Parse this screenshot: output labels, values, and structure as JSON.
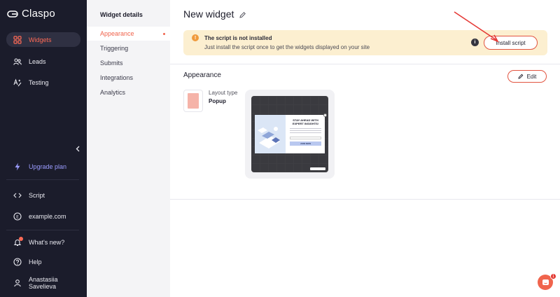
{
  "app": {
    "name": "Claspo"
  },
  "sidebar": {
    "items": [
      {
        "label": "Widgets",
        "icon": "grid-icon",
        "active": true
      },
      {
        "label": "Leads",
        "icon": "users-icon"
      },
      {
        "label": "Testing",
        "icon": "ab-test-icon"
      }
    ],
    "upgrade_label": "Upgrade plan",
    "script_label": "Script",
    "site_label": "example.com",
    "whats_new_label": "What's new?",
    "help_label": "Help",
    "user_first": "Anastasiia",
    "user_last": "Savelieva"
  },
  "subnav": {
    "title": "Widget details",
    "items": [
      {
        "label": "Appearance",
        "active": true
      },
      {
        "label": "Triggering"
      },
      {
        "label": "Submits"
      },
      {
        "label": "Integrations"
      },
      {
        "label": "Analytics"
      }
    ]
  },
  "main": {
    "title": "New widget",
    "alert": {
      "title": "The script is not installed",
      "subtitle": "Just install the script once to get the widgets displayed on your site",
      "button_label": "Install script"
    },
    "section_title": "Appearance",
    "edit_label": "Edit",
    "layout_type_label": "Layout type",
    "layout_type_value": "Popup",
    "preview": {
      "heading": "STAY AHEAD WITH EXPERT INSIGHTS!",
      "button_text": "JOIN NOW"
    }
  },
  "chat": {
    "unread_count": "1"
  },
  "colors": {
    "accent": "#f0644d",
    "sidebar_bg": "#1b1c2b",
    "alert_bg": "#fcefd0",
    "upgrade": "#9b9cff"
  }
}
